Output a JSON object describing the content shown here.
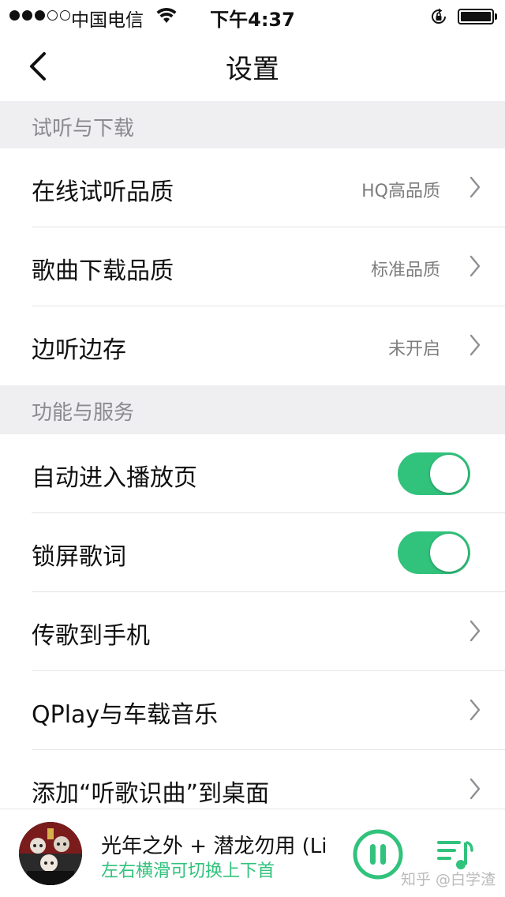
{
  "status_bar": {
    "signal_dots": [
      true,
      true,
      true,
      false,
      false
    ],
    "carrier": "中国电信",
    "time": "下午4:37"
  },
  "nav": {
    "title": "设置"
  },
  "sections": [
    {
      "title": "试听与下载",
      "rows": [
        {
          "label": "在线试听品质",
          "value": "HQ高品质",
          "control": "chevron"
        },
        {
          "label": "歌曲下载品质",
          "value": "标准品质",
          "control": "chevron"
        },
        {
          "label": "边听边存",
          "value": "未开启",
          "control": "chevron"
        }
      ]
    },
    {
      "title": "功能与服务",
      "rows": [
        {
          "label": "自动进入播放页",
          "control": "toggle",
          "on": true
        },
        {
          "label": "锁屏歌词",
          "control": "toggle",
          "on": true
        },
        {
          "label": "传歌到手机",
          "control": "chevron"
        },
        {
          "label": "QPlay与车载音乐",
          "control": "chevron"
        },
        {
          "label": "添加“听歌识曲”到桌面",
          "control": "chevron"
        }
      ]
    }
  ],
  "mini_player": {
    "title": "光年之外 + 潜龙勿用 (Li",
    "subtitle": "左右横滑可切换上下首",
    "playing": true
  },
  "watermark": "知乎 @白学渣",
  "colors": {
    "accent": "#31c27c",
    "section_bg": "#efeff2",
    "value_text": "#7d7d7d"
  },
  "icons": {
    "back": "chevron-left-icon",
    "row_arrow": "chevron-right-icon",
    "wifi": "wifi-icon",
    "orientation_lock": "orientation-lock-icon",
    "battery": "battery-icon",
    "play_state": "pause-icon",
    "playlist": "playlist-icon"
  }
}
